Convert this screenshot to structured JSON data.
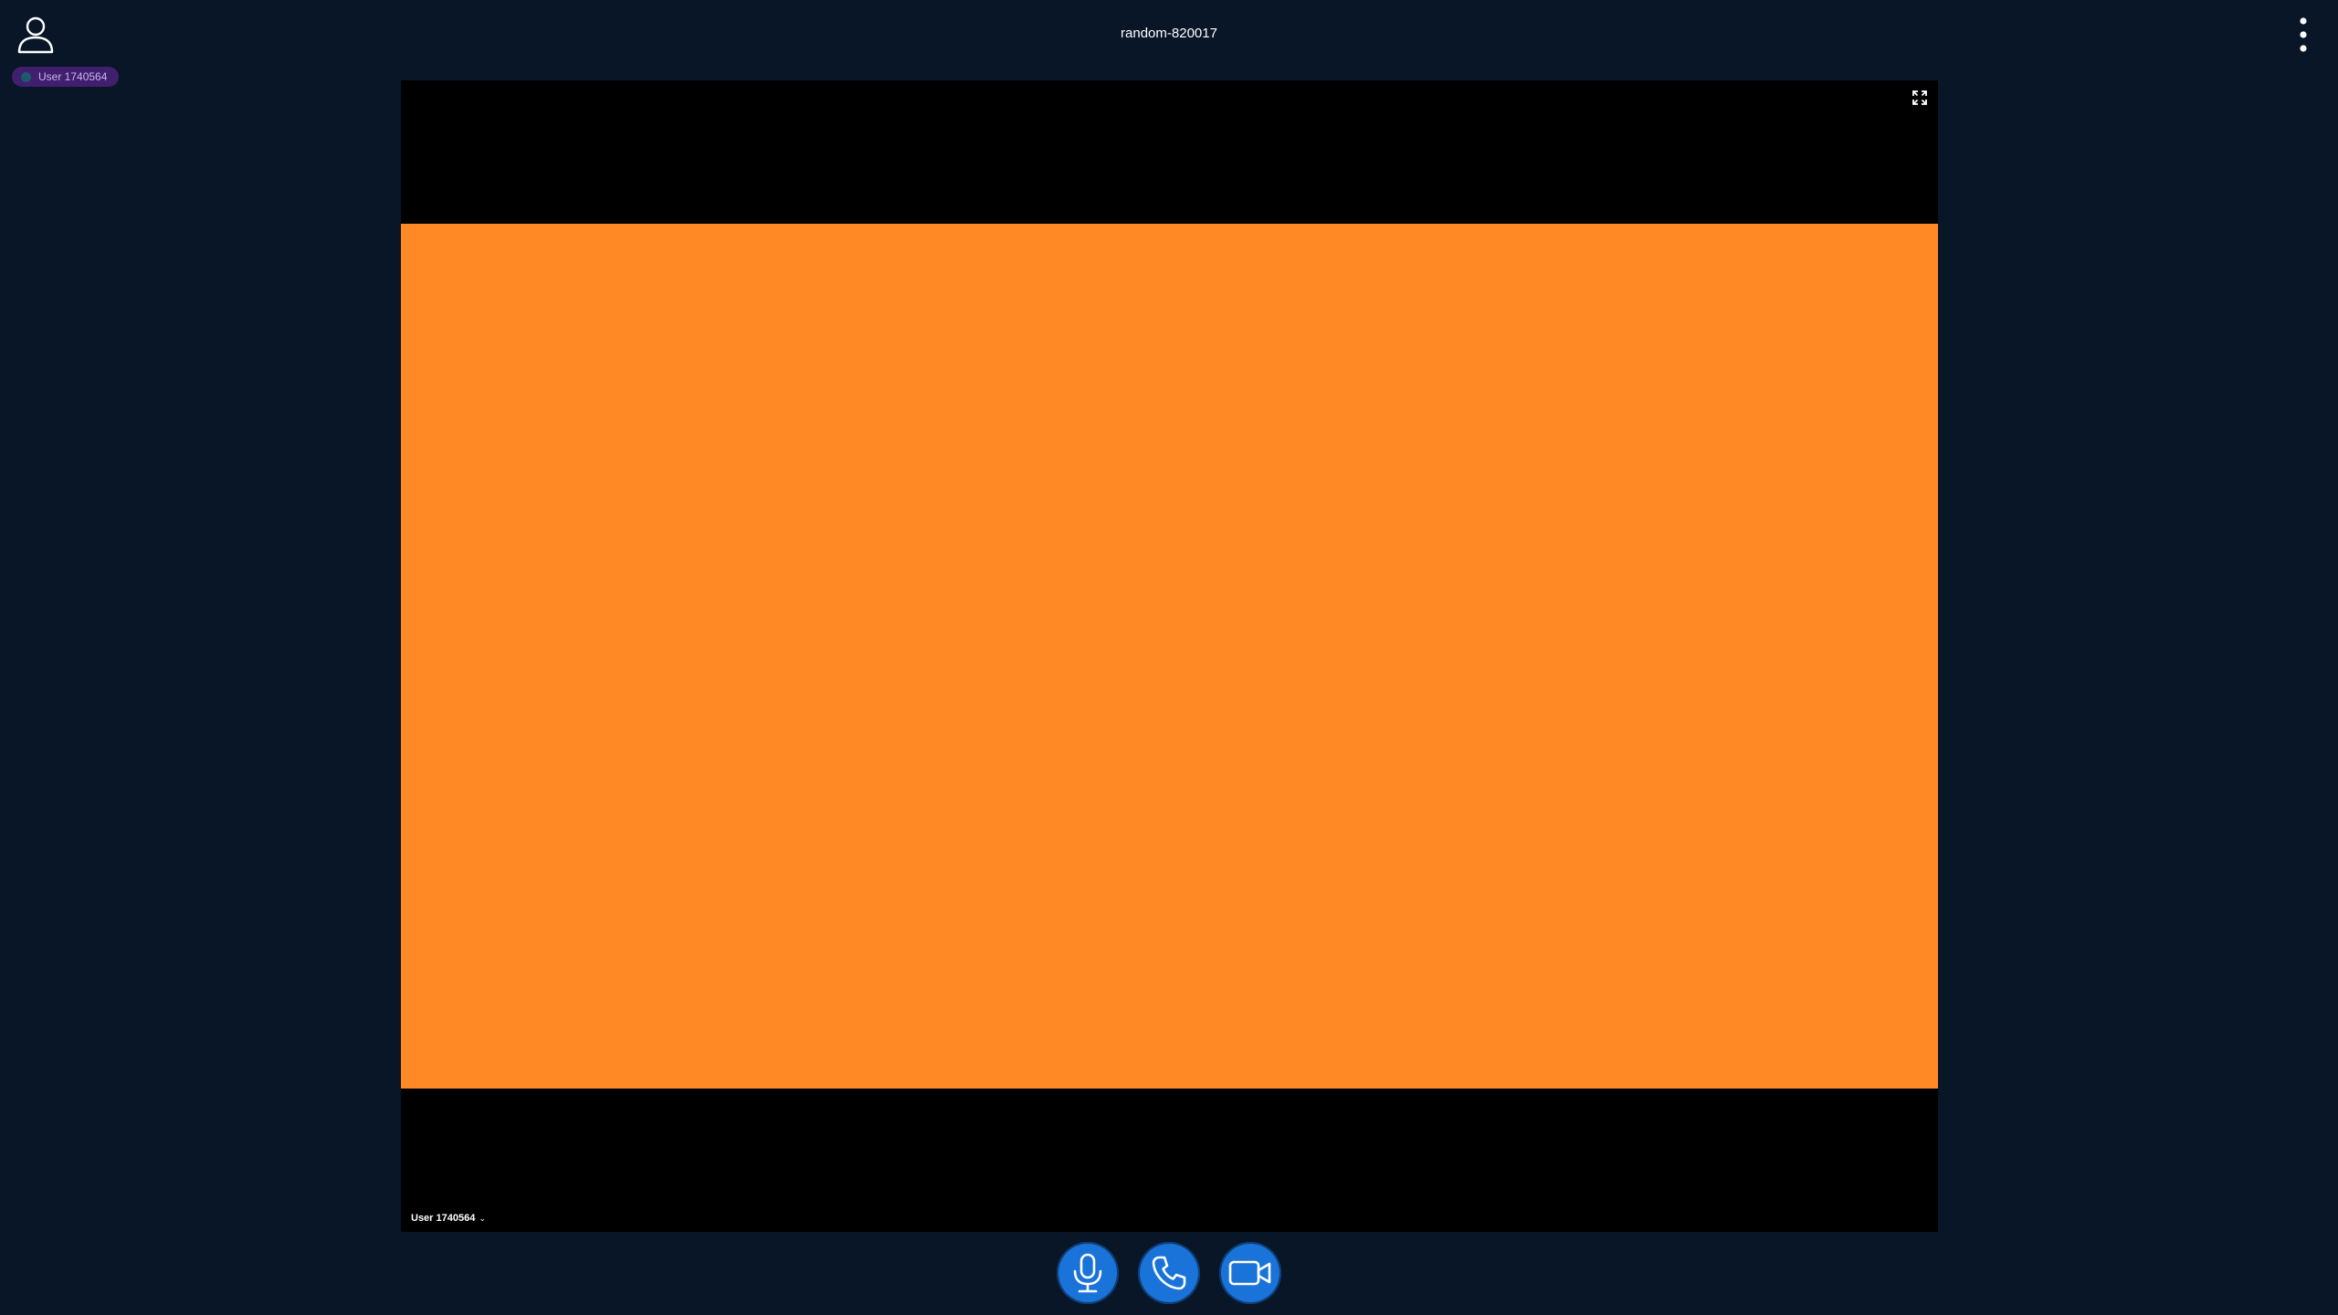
{
  "header": {
    "room_title": "random-820017",
    "profile_icon": "user-icon",
    "menu_icon": "more-vertical-icon"
  },
  "participants": [
    {
      "name": "User 1740564"
    }
  ],
  "video_tile": {
    "label": "User 1740564",
    "caret": "⌄",
    "feed_color": "#ff8a25",
    "fullscreen_icon": "fullscreen-icon"
  },
  "controls": {
    "microphone_icon": "microphone-icon",
    "call_icon": "phone-icon",
    "camera_icon": "video-camera-icon",
    "button_color": "#1a73d9"
  },
  "theme": {
    "background": "#081628",
    "chip_background": "#3f1f6e"
  }
}
